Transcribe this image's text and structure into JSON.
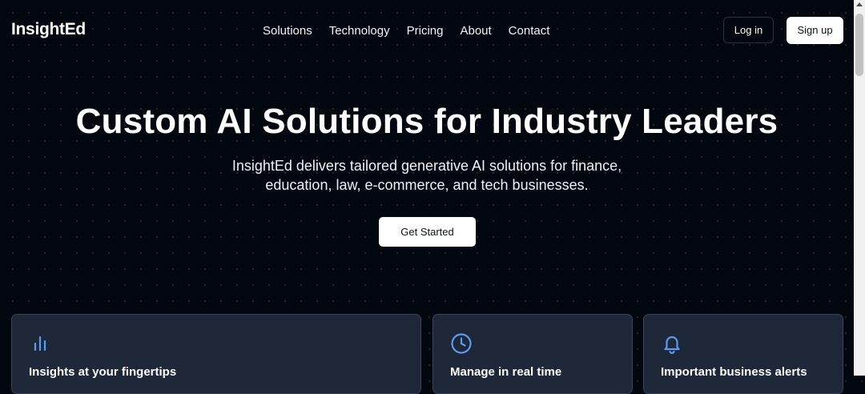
{
  "brand": {
    "name": "InsightEd"
  },
  "nav": {
    "links": [
      "Solutions",
      "Technology",
      "Pricing",
      "About",
      "Contact"
    ],
    "login_label": "Log in",
    "signup_label": "Sign up"
  },
  "hero": {
    "title": "Custom AI Solutions for Industry Leaders",
    "subtitle": "InsightEd delivers tailored generative AI solutions for finance, education, law, e-commerce, and tech businesses.",
    "cta_label": "Get Started"
  },
  "features": [
    {
      "icon": "bar-chart-icon",
      "title": "Insights at your fingertips"
    },
    {
      "icon": "clock-icon",
      "title": "Manage in real time"
    },
    {
      "icon": "bell-icon",
      "title": "Important business alerts"
    }
  ],
  "colors": {
    "background": "#03070f",
    "card": "#1f2838",
    "accent": "#5b9bf0",
    "button": "#ffffff"
  }
}
